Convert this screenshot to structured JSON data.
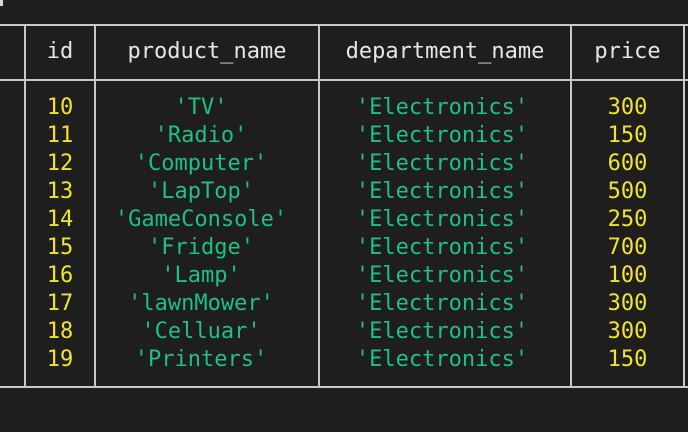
{
  "table": {
    "columns": [
      {
        "key": "id",
        "label": "id"
      },
      {
        "key": "product_name",
        "label": "product_name"
      },
      {
        "key": "department_name",
        "label": "department_name"
      },
      {
        "key": "price",
        "label": "price"
      }
    ],
    "rows": [
      {
        "id": "10",
        "product_name": "'TV'",
        "department_name": "'Electronics'",
        "price": "300"
      },
      {
        "id": "11",
        "product_name": "'Radio'",
        "department_name": "'Electronics'",
        "price": "150"
      },
      {
        "id": "12",
        "product_name": "'Computer'",
        "department_name": "'Electronics'",
        "price": "600"
      },
      {
        "id": "13",
        "product_name": "'LapTop'",
        "department_name": "'Electronics'",
        "price": "500"
      },
      {
        "id": "14",
        "product_name": "'GameConsole'",
        "department_name": "'Electronics'",
        "price": "250"
      },
      {
        "id": "15",
        "product_name": "'Fridge'",
        "department_name": "'Electronics'",
        "price": "700"
      },
      {
        "id": "16",
        "product_name": "'Lamp'",
        "department_name": "'Electronics'",
        "price": "100"
      },
      {
        "id": "17",
        "product_name": "'lawnMower'",
        "department_name": "'Electronics'",
        "price": "300"
      },
      {
        "id": "18",
        "product_name": "'Celluar'",
        "department_name": "'Electronics'",
        "price": "300"
      },
      {
        "id": "19",
        "product_name": "'Printers'",
        "department_name": "'Electronics'",
        "price": "150"
      }
    ]
  },
  "colors": {
    "background": "#1e1e1e",
    "border": "#c8c8c8",
    "header_text": "#e6e6e6",
    "number": "#f2e42c",
    "string": "#1fbf86"
  }
}
